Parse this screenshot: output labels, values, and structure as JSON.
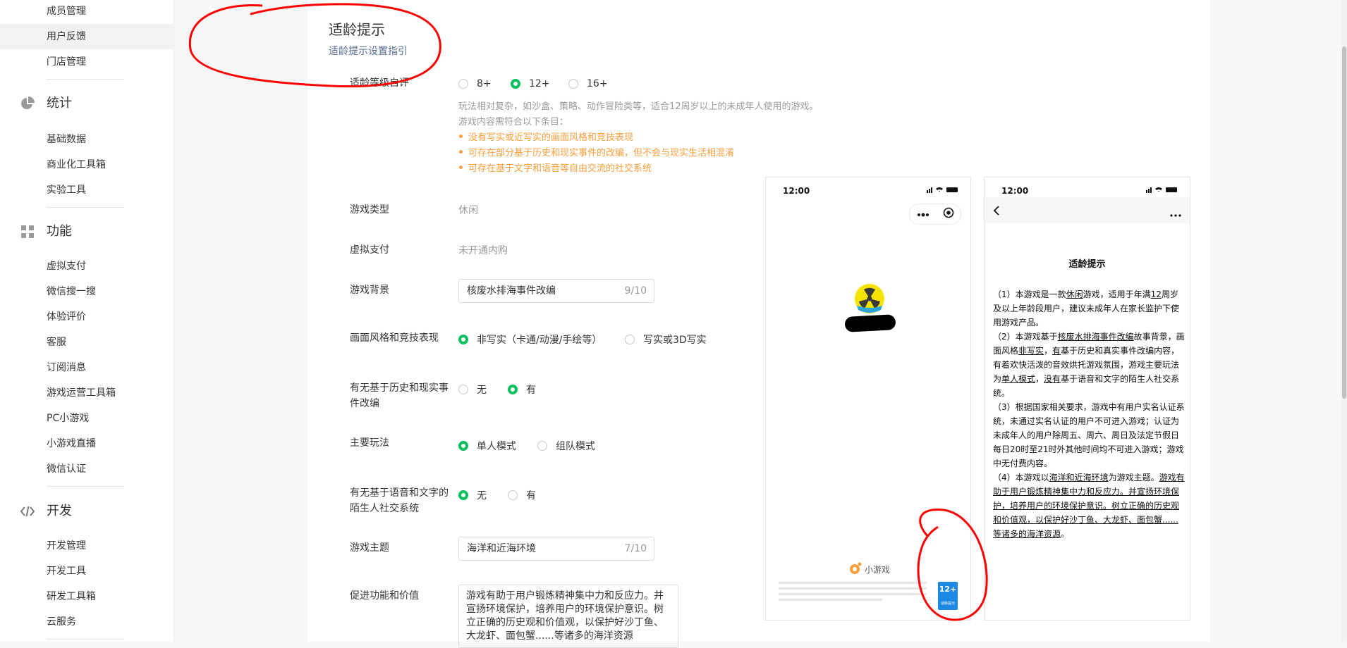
{
  "sidebar": {
    "items_top": [
      "成员管理",
      "用户反馈",
      "门店管理"
    ],
    "sections": [
      {
        "title": "统计",
        "icon": "pie-chart-icon",
        "items": [
          "基础数据",
          "商业化工具箱",
          "实验工具"
        ]
      },
      {
        "title": "功能",
        "icon": "grid-icon",
        "items": [
          "虚拟支付",
          "微信搜一搜",
          "体验评价",
          "客服",
          "订阅消息",
          "游戏运营工具箱",
          "PC小游戏",
          "小游戏直播",
          "微信认证"
        ]
      },
      {
        "title": "开发",
        "icon": "code-icon",
        "items": [
          "开发管理",
          "开发工具",
          "研发工具箱",
          "云服务"
        ]
      }
    ]
  },
  "page": {
    "title": "适龄提示",
    "guide_link": "适龄提示设置指引"
  },
  "form": {
    "age_rating": {
      "label": "适龄等级自评",
      "options": [
        "8+",
        "12+",
        "16+"
      ],
      "selected": "12+",
      "desc1": "玩法相对复杂，如沙盒、策略、动作冒险类等，适合12周岁以上的未成年人使用的游戏。",
      "desc2": "游戏内容需符合以下条目：",
      "bullets": [
        "没有写实或近写实的画面风格和竞技表现",
        "可存在部分基于历史和现实事件的改编，但不会与现实生活相混淆",
        "可存在基于文字和语音等自由交流的社交系统"
      ]
    },
    "game_type": {
      "label": "游戏类型",
      "value": "休闲"
    },
    "virtual_pay": {
      "label": "虚拟支付",
      "value": "未开通内购"
    },
    "background": {
      "label": "游戏背景",
      "value": "核废水排海事件改编",
      "count": "9/10"
    },
    "art_style": {
      "label": "画面风格和竞技表现",
      "options": [
        "非写实（卡通/动漫/手绘等）",
        "写实或3D写实"
      ],
      "selected": "非写实（卡通/动漫/手绘等）"
    },
    "history": {
      "label": "有无基于历史和现实事件改编",
      "options": [
        "无",
        "有"
      ],
      "selected": "有"
    },
    "gameplay": {
      "label": "主要玩法",
      "options": [
        "单人模式",
        "组队模式"
      ],
      "selected": "单人模式"
    },
    "social": {
      "label": "有无基于语音和文字的陌生人社交系统",
      "options": [
        "无",
        "有"
      ],
      "selected": "无"
    },
    "theme": {
      "label": "游戏主题",
      "value": "海洋和近海环境",
      "count": "7/10"
    },
    "value": {
      "label": "促进功能和价值",
      "text": "游戏有助于用户锻炼精神集中力和反应力。并宣扬环境保护，培养用户的环境保护意识。树立正确的历史观和价值观，以保护好沙丁鱼、大龙虾、面包蟹......等诸多的海洋资源"
    }
  },
  "preview_left": {
    "time": "12:00",
    "brand": "小游戏",
    "badge": "12+",
    "badge_sub": "适龄提示"
  },
  "preview_right": {
    "time": "12:00",
    "heading": "适龄提示",
    "p1_a": "（1）本游戏是一款",
    "p1_u1": "休闲",
    "p1_b": "游戏，适用于年满",
    "p1_u2": "12",
    "p1_c": "周岁及以上年龄段用户，建议未成年人在家长监护下使用游戏产品。",
    "p2_a": "（2）本游戏基于",
    "p2_u1": "核废水排海事件改编",
    "p2_b": "故事背景，画面风格",
    "p2_u2": "非写实",
    "p2_c": "，",
    "p2_u3": "有",
    "p2_d": "基于历史和真实事件改编内容，有着欢快活泼的音效烘托游戏氛围，游戏主要玩法为",
    "p2_u4": "单人模式",
    "p2_e": "，",
    "p2_u5": "没有",
    "p2_f": "基于语音和文字的陌生人社交系统。",
    "p3": "（3）根据国家相关要求，游戏中有用户实名认证系统，未通过实名认证的用户不可进入游戏；认证为未成年人的用户除周五、周六、周日及法定节假日每日20时至21时外其他时间均不可进入游戏；游戏中无付费内容。",
    "p4_a": "（4）本游戏以",
    "p4_u1": "海洋和近海环境",
    "p4_b": "为游戏主题。",
    "p4_u2": "游戏有助于用户锻炼精神集中力和反应力。并宣扬环境保护，培养用户的环境保护意识。树立正确的历史观和价值观，以保护好沙丁鱼、大龙虾、面包蟹......等诸多的海洋资源",
    "p4_c": "。"
  },
  "colors": {
    "accent_green": "#07c160",
    "warning_orange": "#fa9d3b",
    "link_blue": "#576b95",
    "annotation_red": "#ff0000"
  }
}
